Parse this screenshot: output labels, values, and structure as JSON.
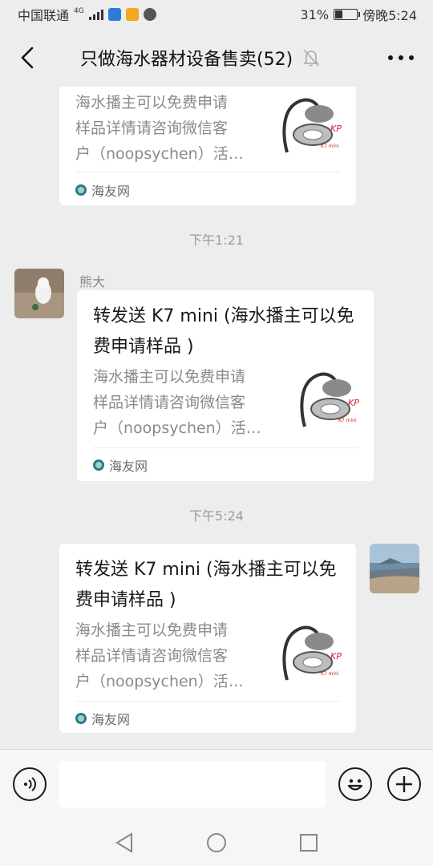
{
  "status_bar": {
    "carrier": "中国联通",
    "network": "4G",
    "battery_text": "31%",
    "battery_level": 0.31,
    "time": "傍晚5:24"
  },
  "header": {
    "title": "只做海水器材设备售卖(52)",
    "back_icon": "chevron-left-icon",
    "mute_icon": "bell-muted-icon",
    "more_icon": "more-dots-icon"
  },
  "messages": [
    {
      "type": "link_card",
      "title": "",
      "description": "海水播主可以免费申请\n样品详情请咨询微信客\n户（noopsychen）活…",
      "source": "海友网",
      "thumb_brand": "KP",
      "thumb_model": "K7 mini"
    },
    {
      "type": "timestamp",
      "text": "下午1:21"
    },
    {
      "type": "link_card",
      "sender": "熊大",
      "title": "转发送 K7 mini (海水播主可以免费申请样品 )",
      "description": "海水播主可以免费申请\n样品详情请咨询微信客\n户（noopsychen）活…",
      "source": "海友网",
      "thumb_brand": "KP",
      "thumb_model": "K7 mini"
    },
    {
      "type": "timestamp",
      "text": "下午5:24"
    },
    {
      "type": "link_card",
      "sender": "me",
      "title": "转发送 K7 mini (海水播主可以免费申请样品 )",
      "description": "海水播主可以免费申请\n样品详情请咨询微信客\n户（noopsychen）活…",
      "source": "海友网",
      "thumb_brand": "KP",
      "thumb_model": "K7 mini"
    }
  ],
  "input_bar": {
    "voice_icon": "voice-icon",
    "emoji_icon": "emoji-icon",
    "plus_icon": "plus-icon"
  },
  "nav_bar": {
    "back_icon": "triangle-back-icon",
    "home_icon": "circle-home-icon",
    "recents_icon": "square-recents-icon"
  },
  "colors": {
    "background": "#ededed",
    "card": "#ffffff",
    "meta_text": "#9b9b9b"
  }
}
